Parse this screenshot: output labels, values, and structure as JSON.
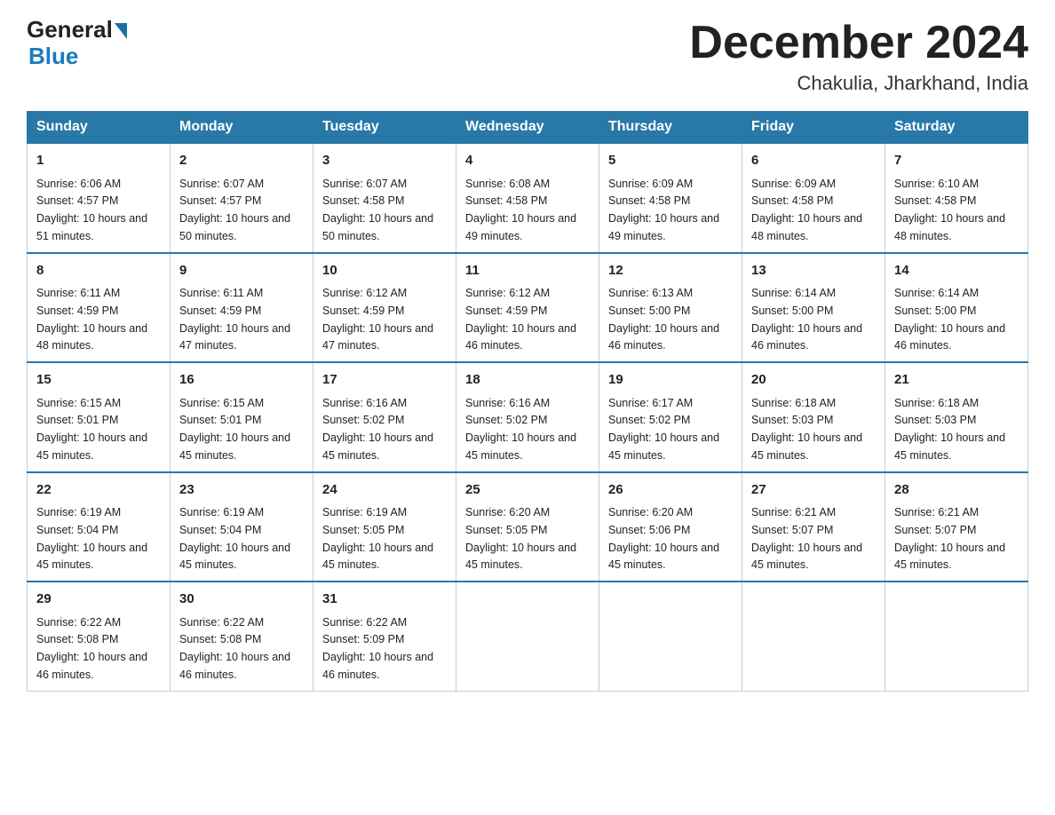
{
  "header": {
    "logo_general": "General",
    "logo_blue": "Blue",
    "month_title": "December 2024",
    "location": "Chakulia, Jharkhand, India"
  },
  "days_of_week": [
    "Sunday",
    "Monday",
    "Tuesday",
    "Wednesday",
    "Thursday",
    "Friday",
    "Saturday"
  ],
  "weeks": [
    [
      {
        "day": "1",
        "sunrise": "6:06 AM",
        "sunset": "4:57 PM",
        "daylight": "10 hours and 51 minutes."
      },
      {
        "day": "2",
        "sunrise": "6:07 AM",
        "sunset": "4:57 PM",
        "daylight": "10 hours and 50 minutes."
      },
      {
        "day": "3",
        "sunrise": "6:07 AM",
        "sunset": "4:58 PM",
        "daylight": "10 hours and 50 minutes."
      },
      {
        "day": "4",
        "sunrise": "6:08 AM",
        "sunset": "4:58 PM",
        "daylight": "10 hours and 49 minutes."
      },
      {
        "day": "5",
        "sunrise": "6:09 AM",
        "sunset": "4:58 PM",
        "daylight": "10 hours and 49 minutes."
      },
      {
        "day": "6",
        "sunrise": "6:09 AM",
        "sunset": "4:58 PM",
        "daylight": "10 hours and 48 minutes."
      },
      {
        "day": "7",
        "sunrise": "6:10 AM",
        "sunset": "4:58 PM",
        "daylight": "10 hours and 48 minutes."
      }
    ],
    [
      {
        "day": "8",
        "sunrise": "6:11 AM",
        "sunset": "4:59 PM",
        "daylight": "10 hours and 48 minutes."
      },
      {
        "day": "9",
        "sunrise": "6:11 AM",
        "sunset": "4:59 PM",
        "daylight": "10 hours and 47 minutes."
      },
      {
        "day": "10",
        "sunrise": "6:12 AM",
        "sunset": "4:59 PM",
        "daylight": "10 hours and 47 minutes."
      },
      {
        "day": "11",
        "sunrise": "6:12 AM",
        "sunset": "4:59 PM",
        "daylight": "10 hours and 46 minutes."
      },
      {
        "day": "12",
        "sunrise": "6:13 AM",
        "sunset": "5:00 PM",
        "daylight": "10 hours and 46 minutes."
      },
      {
        "day": "13",
        "sunrise": "6:14 AM",
        "sunset": "5:00 PM",
        "daylight": "10 hours and 46 minutes."
      },
      {
        "day": "14",
        "sunrise": "6:14 AM",
        "sunset": "5:00 PM",
        "daylight": "10 hours and 46 minutes."
      }
    ],
    [
      {
        "day": "15",
        "sunrise": "6:15 AM",
        "sunset": "5:01 PM",
        "daylight": "10 hours and 45 minutes."
      },
      {
        "day": "16",
        "sunrise": "6:15 AM",
        "sunset": "5:01 PM",
        "daylight": "10 hours and 45 minutes."
      },
      {
        "day": "17",
        "sunrise": "6:16 AM",
        "sunset": "5:02 PM",
        "daylight": "10 hours and 45 minutes."
      },
      {
        "day": "18",
        "sunrise": "6:16 AM",
        "sunset": "5:02 PM",
        "daylight": "10 hours and 45 minutes."
      },
      {
        "day": "19",
        "sunrise": "6:17 AM",
        "sunset": "5:02 PM",
        "daylight": "10 hours and 45 minutes."
      },
      {
        "day": "20",
        "sunrise": "6:18 AM",
        "sunset": "5:03 PM",
        "daylight": "10 hours and 45 minutes."
      },
      {
        "day": "21",
        "sunrise": "6:18 AM",
        "sunset": "5:03 PM",
        "daylight": "10 hours and 45 minutes."
      }
    ],
    [
      {
        "day": "22",
        "sunrise": "6:19 AM",
        "sunset": "5:04 PM",
        "daylight": "10 hours and 45 minutes."
      },
      {
        "day": "23",
        "sunrise": "6:19 AM",
        "sunset": "5:04 PM",
        "daylight": "10 hours and 45 minutes."
      },
      {
        "day": "24",
        "sunrise": "6:19 AM",
        "sunset": "5:05 PM",
        "daylight": "10 hours and 45 minutes."
      },
      {
        "day": "25",
        "sunrise": "6:20 AM",
        "sunset": "5:05 PM",
        "daylight": "10 hours and 45 minutes."
      },
      {
        "day": "26",
        "sunrise": "6:20 AM",
        "sunset": "5:06 PM",
        "daylight": "10 hours and 45 minutes."
      },
      {
        "day": "27",
        "sunrise": "6:21 AM",
        "sunset": "5:07 PM",
        "daylight": "10 hours and 45 minutes."
      },
      {
        "day": "28",
        "sunrise": "6:21 AM",
        "sunset": "5:07 PM",
        "daylight": "10 hours and 45 minutes."
      }
    ],
    [
      {
        "day": "29",
        "sunrise": "6:22 AM",
        "sunset": "5:08 PM",
        "daylight": "10 hours and 46 minutes."
      },
      {
        "day": "30",
        "sunrise": "6:22 AM",
        "sunset": "5:08 PM",
        "daylight": "10 hours and 46 minutes."
      },
      {
        "day": "31",
        "sunrise": "6:22 AM",
        "sunset": "5:09 PM",
        "daylight": "10 hours and 46 minutes."
      },
      null,
      null,
      null,
      null
    ]
  ]
}
